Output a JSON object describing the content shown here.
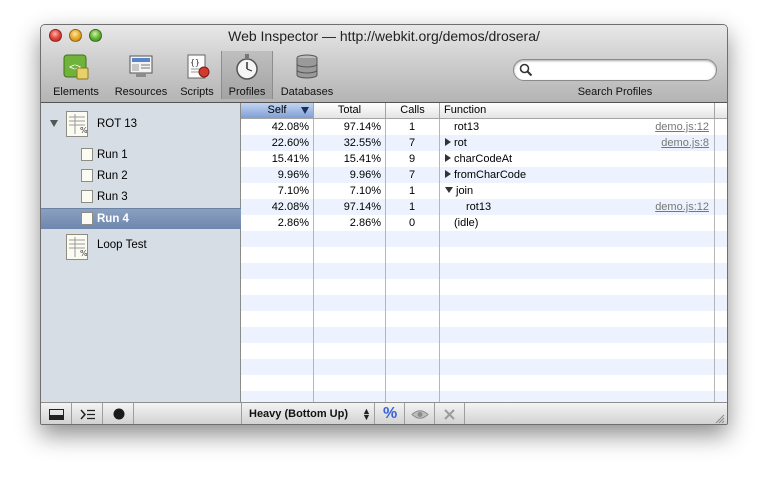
{
  "window": {
    "title": "Web Inspector — http://webkit.org/demos/drosera/"
  },
  "toolbar": {
    "items": [
      {
        "label": "Elements"
      },
      {
        "label": "Resources"
      },
      {
        "label": "Scripts"
      },
      {
        "label": "Profiles",
        "selected": true
      },
      {
        "label": "Databases"
      }
    ],
    "search": {
      "value": "",
      "placeholder": "",
      "label": "Search Profiles"
    }
  },
  "sidebar": {
    "groups": [
      {
        "title": "ROT 13",
        "expanded": true,
        "children": [
          {
            "label": "Run 1"
          },
          {
            "label": "Run 2"
          },
          {
            "label": "Run 3"
          },
          {
            "label": "Run 4",
            "selected": true
          }
        ]
      },
      {
        "title": "Loop Test",
        "expanded": false,
        "children": []
      }
    ]
  },
  "profile_table": {
    "columns": {
      "self": "Self",
      "total": "Total",
      "calls": "Calls",
      "function": "Function"
    },
    "sorted_by": "Self",
    "sort_direction": "descending",
    "rows": [
      {
        "self": "42.08%",
        "total": "97.14%",
        "calls": "1",
        "function": "rot13",
        "link": "demo.js:12",
        "expander": "none",
        "indent": 0
      },
      {
        "self": "22.60%",
        "total": "32.55%",
        "calls": "7",
        "function": "rot",
        "link": "demo.js:8",
        "expander": "collapsed",
        "indent": 0
      },
      {
        "self": "15.41%",
        "total": "15.41%",
        "calls": "9",
        "function": "charCodeAt",
        "link": "",
        "expander": "collapsed",
        "indent": 0
      },
      {
        "self": "9.96%",
        "total": "9.96%",
        "calls": "7",
        "function": "fromCharCode",
        "link": "",
        "expander": "collapsed",
        "indent": 0
      },
      {
        "self": "7.10%",
        "total": "7.10%",
        "calls": "1",
        "function": "join",
        "link": "",
        "expander": "expanded",
        "indent": 0
      },
      {
        "self": "42.08%",
        "total": "97.14%",
        "calls": "1",
        "function": "rot13",
        "link": "demo.js:12",
        "expander": "none",
        "indent": 1
      },
      {
        "self": "2.86%",
        "total": "2.86%",
        "calls": "0",
        "function": "(idle)",
        "link": "",
        "expander": "none",
        "indent": 0
      }
    ]
  },
  "statusbar": {
    "view_mode": "Heavy (Bottom Up)",
    "percent_symbol": "%",
    "percent_active": true
  },
  "colors": {
    "selection_blue": "#7189b0",
    "sidebar_bg": "#d6dde5",
    "row_stripe": "#edf3fe",
    "link_gray": "#777777",
    "percent_blue": "#3a62d6"
  }
}
